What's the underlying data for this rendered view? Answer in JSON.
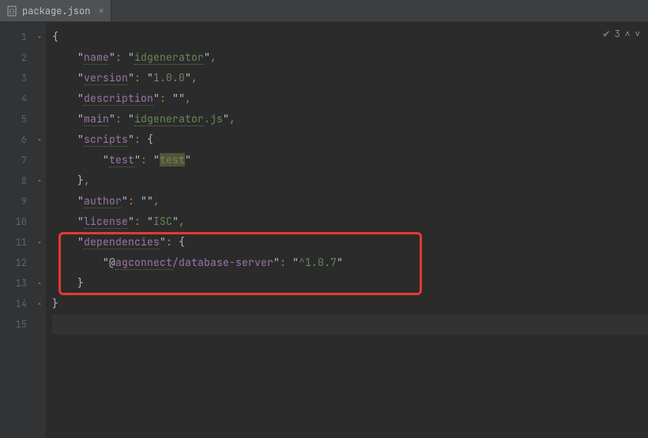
{
  "tab": {
    "filename": "package.json",
    "icon": "json-file-icon"
  },
  "inspections": {
    "count": "3"
  },
  "lines": {
    "1": {
      "tokens": [
        "{"
      ]
    },
    "2": {
      "key": "name",
      "value": "idgenerator",
      "comma": true,
      "valueWarn": true
    },
    "3": {
      "key": "version",
      "value": "1.0.0",
      "comma": true
    },
    "4": {
      "key": "description",
      "value": "",
      "comma": true
    },
    "5": {
      "key": "main",
      "valuePrefix": "idgenerator",
      "valueSuffix": ".js",
      "comma": true,
      "valueWarn": true
    },
    "6": {
      "key": "scripts",
      "open": "{"
    },
    "7": {
      "key": "test",
      "value": "test",
      "hl": true,
      "indent": 2
    },
    "8": {
      "close": "},",
      "indent": 1
    },
    "9": {
      "key": "author",
      "value": "",
      "comma": true
    },
    "10": {
      "key": "license",
      "value": "ISC",
      "comma": true
    },
    "11": {
      "key": "dependencies",
      "open": "{"
    },
    "12": {
      "key": "@agconnect/database-server",
      "keySegWarn": "agconnect",
      "value": "^1.0.7",
      "indent": 2
    },
    "13": {
      "close": "}",
      "indent": 1
    },
    "14": {
      "tokens": [
        "}"
      ]
    }
  },
  "highlight": {
    "startLine": 11,
    "endLine": 13
  }
}
